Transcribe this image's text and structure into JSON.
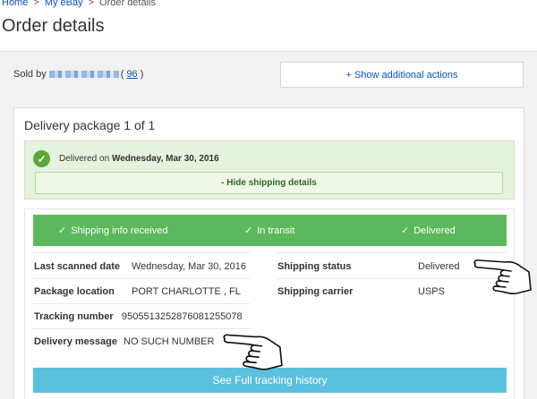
{
  "breadcrumb": {
    "home": "Home",
    "my_ebay": "My eBay",
    "current": "Order details",
    "separator": ">"
  },
  "page_title": "Order details",
  "seller": {
    "prefix": "Sold by",
    "feedback_open": "(",
    "feedback_score": "96",
    "feedback_close": ")"
  },
  "actions_button": "+ Show additional actions",
  "package": {
    "title": "Delivery package 1 of 1",
    "delivered_prefix": "Delivered on",
    "delivered_date": "Wednesday, Mar 30, 2016",
    "hide_details": "- Hide shipping details",
    "steps": [
      {
        "label": "Shipping info received",
        "tick": "✓"
      },
      {
        "label": "In transit",
        "tick": "✓"
      },
      {
        "label": "Delivered",
        "tick": "✓"
      }
    ],
    "details": {
      "last_scanned_label": "Last scanned date",
      "last_scanned_value": "Wednesday, Mar 30, 2016",
      "shipping_status_label": "Shipping status",
      "shipping_status_value": "Delivered",
      "package_location_label": "Package location",
      "package_location_value": "PORT CHARLOTTE , FL",
      "shipping_carrier_label": "Shipping carrier",
      "shipping_carrier_value": "USPS",
      "tracking_number_label": "Tracking number",
      "tracking_number_value": "9505513252876081255078",
      "delivery_message_label": "Delivery message",
      "delivery_message_value": "NO SUCH NUMBER"
    },
    "full_history_button": "See Full tracking history"
  },
  "colors": {
    "link": "#0654ba",
    "progress_green": "#5cb85c",
    "history_blue": "#5bc0de",
    "delivered_bg": "#e5f2de",
    "check_green": "#5ba838"
  },
  "icons": {
    "check": "check-circle-icon",
    "pointing_hand": "pointing-hand-icon"
  }
}
